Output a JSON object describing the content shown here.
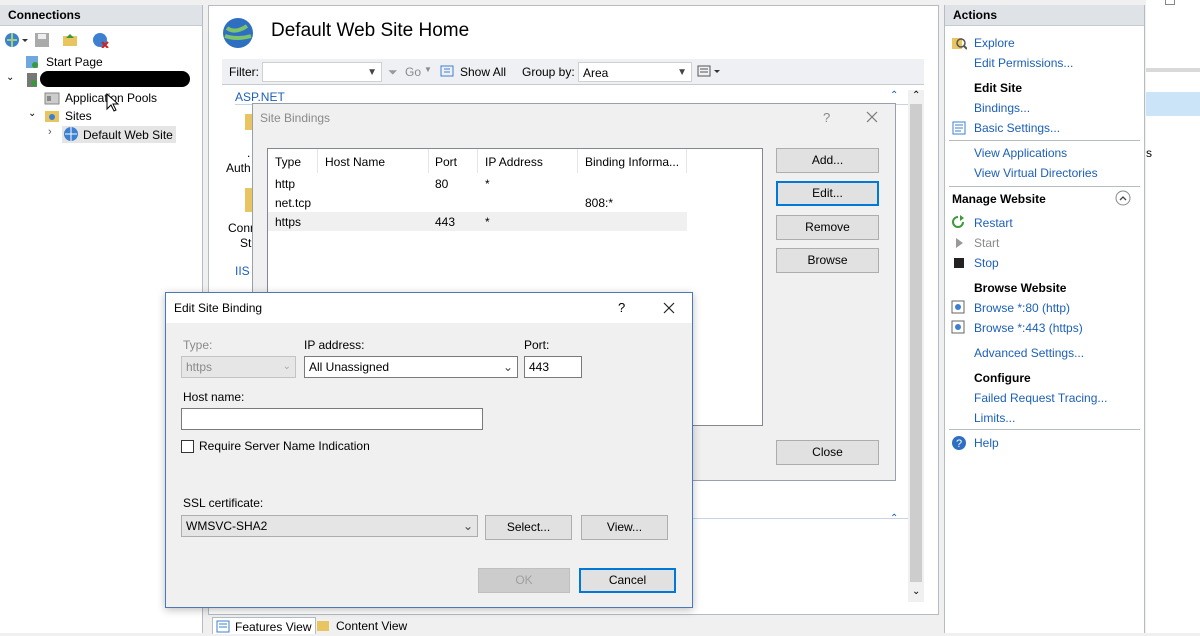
{
  "connections": {
    "title": "Connections",
    "tree": {
      "start_page": "Start Page",
      "app_pools": "Application Pools",
      "sites": "Sites",
      "default_site": "Default Web Site"
    }
  },
  "main": {
    "title": "Default Web Site Home",
    "filter_label": "Filter:",
    "go_label": "Go",
    "show_all_label": "Show All",
    "group_by_label": "Group by:",
    "group_by_value": "Area",
    "section_aspnet": "ASP.NET",
    "section_iis": "IIS",
    "partial_label_1": ".",
    "partial_label_2": "Auth",
    "partial_label_3": "Conn",
    "partial_label_4": "St",
    "features_view": "Features View",
    "content_view": "Content View"
  },
  "site_bindings": {
    "title": "Site Bindings",
    "help": "?",
    "columns": [
      "Type",
      "Host Name",
      "Port",
      "IP Address",
      "Binding Informa..."
    ],
    "rows": [
      {
        "type": "http",
        "host": "",
        "port": "80",
        "ip": "*",
        "info": ""
      },
      {
        "type": "net.tcp",
        "host": "",
        "port": "",
        "ip": "",
        "info": "808:*"
      },
      {
        "type": "https",
        "host": "",
        "port": "443",
        "ip": "*",
        "info": ""
      }
    ],
    "add": "Add...",
    "edit": "Edit...",
    "remove": "Remove",
    "browse": "Browse",
    "close": "Close"
  },
  "edit_binding": {
    "title": "Edit Site Binding",
    "help": "?",
    "type_label": "Type:",
    "type_value": "https",
    "ip_label": "IP address:",
    "ip_value": "All Unassigned",
    "port_label": "Port:",
    "port_value": "443",
    "host_label": "Host name:",
    "host_value": "",
    "sni_label": "Require Server Name Indication",
    "ssl_label": "SSL certificate:",
    "ssl_value": "WMSVC-SHA2",
    "select": "Select...",
    "view": "View...",
    "ok": "OK",
    "cancel": "Cancel"
  },
  "actions": {
    "title": "Actions",
    "explore": "Explore",
    "edit_permissions": "Edit Permissions...",
    "edit_site": "Edit Site",
    "bindings": "Bindings...",
    "basic_settings": "Basic Settings...",
    "view_applications": "View Applications",
    "view_vdirs": "View Virtual Directories",
    "manage_website": "Manage Website",
    "restart": "Restart",
    "start": "Start",
    "stop": "Stop",
    "browse_website": "Browse Website",
    "browse_80": "Browse *:80 (http)",
    "browse_443": "Browse *:443 (https)",
    "advanced_settings": "Advanced Settings...",
    "configure": "Configure",
    "failed_request": "Failed Request Tracing...",
    "limits": "Limits...",
    "help": "Help"
  },
  "right_edge": {
    "fragment": "s"
  }
}
